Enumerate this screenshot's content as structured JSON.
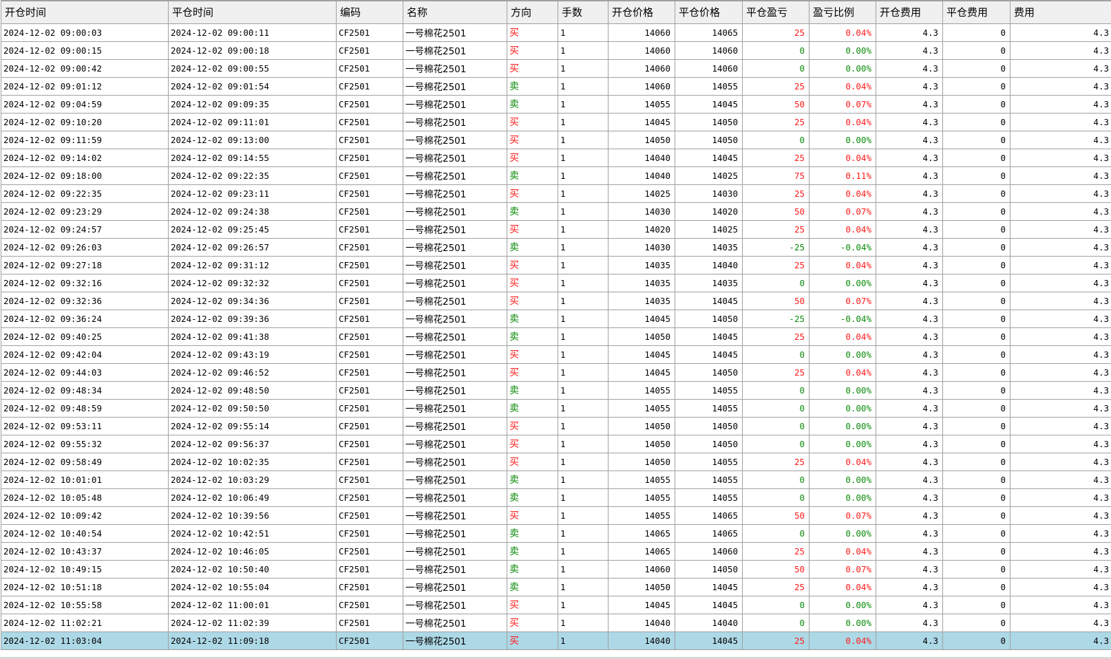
{
  "colors": {
    "buy": "#ff1a1a",
    "sell": "#0a8a0a",
    "gain": "#ff1a1a",
    "flat": "#0a8a0a",
    "loss": "#0a8a0a",
    "selected_row_bg": "#add8e6"
  },
  "selected_row_index": 34,
  "columns": [
    "开仓时间",
    "平仓时间",
    "编码",
    "名称",
    "方向",
    "手数",
    "开仓价格",
    "平仓价格",
    "平仓盈亏",
    "盈亏比例",
    "开仓费用",
    "平仓费用",
    "费用"
  ],
  "rows": [
    [
      "2024-12-02 09:00:03",
      "2024-12-02 09:00:11",
      "CF2501",
      "一号棉花2501",
      "买",
      "1",
      "14060",
      "14065",
      "25",
      "0.04%",
      "4.3",
      "0",
      "4.3"
    ],
    [
      "2024-12-02 09:00:15",
      "2024-12-02 09:00:18",
      "CF2501",
      "一号棉花2501",
      "买",
      "1",
      "14060",
      "14060",
      "0",
      "0.00%",
      "4.3",
      "0",
      "4.3"
    ],
    [
      "2024-12-02 09:00:42",
      "2024-12-02 09:00:55",
      "CF2501",
      "一号棉花2501",
      "买",
      "1",
      "14060",
      "14060",
      "0",
      "0.00%",
      "4.3",
      "0",
      "4.3"
    ],
    [
      "2024-12-02 09:01:12",
      "2024-12-02 09:01:54",
      "CF2501",
      "一号棉花2501",
      "卖",
      "1",
      "14060",
      "14055",
      "25",
      "0.04%",
      "4.3",
      "0",
      "4.3"
    ],
    [
      "2024-12-02 09:04:59",
      "2024-12-02 09:09:35",
      "CF2501",
      "一号棉花2501",
      "卖",
      "1",
      "14055",
      "14045",
      "50",
      "0.07%",
      "4.3",
      "0",
      "4.3"
    ],
    [
      "2024-12-02 09:10:20",
      "2024-12-02 09:11:01",
      "CF2501",
      "一号棉花2501",
      "买",
      "1",
      "14045",
      "14050",
      "25",
      "0.04%",
      "4.3",
      "0",
      "4.3"
    ],
    [
      "2024-12-02 09:11:59",
      "2024-12-02 09:13:00",
      "CF2501",
      "一号棉花2501",
      "买",
      "1",
      "14050",
      "14050",
      "0",
      "0.00%",
      "4.3",
      "0",
      "4.3"
    ],
    [
      "2024-12-02 09:14:02",
      "2024-12-02 09:14:55",
      "CF2501",
      "一号棉花2501",
      "买",
      "1",
      "14040",
      "14045",
      "25",
      "0.04%",
      "4.3",
      "0",
      "4.3"
    ],
    [
      "2024-12-02 09:18:00",
      "2024-12-02 09:22:35",
      "CF2501",
      "一号棉花2501",
      "卖",
      "1",
      "14040",
      "14025",
      "75",
      "0.11%",
      "4.3",
      "0",
      "4.3"
    ],
    [
      "2024-12-02 09:22:35",
      "2024-12-02 09:23:11",
      "CF2501",
      "一号棉花2501",
      "买",
      "1",
      "14025",
      "14030",
      "25",
      "0.04%",
      "4.3",
      "0",
      "4.3"
    ],
    [
      "2024-12-02 09:23:29",
      "2024-12-02 09:24:38",
      "CF2501",
      "一号棉花2501",
      "卖",
      "1",
      "14030",
      "14020",
      "50",
      "0.07%",
      "4.3",
      "0",
      "4.3"
    ],
    [
      "2024-12-02 09:24:57",
      "2024-12-02 09:25:45",
      "CF2501",
      "一号棉花2501",
      "买",
      "1",
      "14020",
      "14025",
      "25",
      "0.04%",
      "4.3",
      "0",
      "4.3"
    ],
    [
      "2024-12-02 09:26:03",
      "2024-12-02 09:26:57",
      "CF2501",
      "一号棉花2501",
      "卖",
      "1",
      "14030",
      "14035",
      "-25",
      "-0.04%",
      "4.3",
      "0",
      "4.3"
    ],
    [
      "2024-12-02 09:27:18",
      "2024-12-02 09:31:12",
      "CF2501",
      "一号棉花2501",
      "买",
      "1",
      "14035",
      "14040",
      "25",
      "0.04%",
      "4.3",
      "0",
      "4.3"
    ],
    [
      "2024-12-02 09:32:16",
      "2024-12-02 09:32:32",
      "CF2501",
      "一号棉花2501",
      "买",
      "1",
      "14035",
      "14035",
      "0",
      "0.00%",
      "4.3",
      "0",
      "4.3"
    ],
    [
      "2024-12-02 09:32:36",
      "2024-12-02 09:34:36",
      "CF2501",
      "一号棉花2501",
      "买",
      "1",
      "14035",
      "14045",
      "50",
      "0.07%",
      "4.3",
      "0",
      "4.3"
    ],
    [
      "2024-12-02 09:36:24",
      "2024-12-02 09:39:36",
      "CF2501",
      "一号棉花2501",
      "卖",
      "1",
      "14045",
      "14050",
      "-25",
      "-0.04%",
      "4.3",
      "0",
      "4.3"
    ],
    [
      "2024-12-02 09:40:25",
      "2024-12-02 09:41:38",
      "CF2501",
      "一号棉花2501",
      "卖",
      "1",
      "14050",
      "14045",
      "25",
      "0.04%",
      "4.3",
      "0",
      "4.3"
    ],
    [
      "2024-12-02 09:42:04",
      "2024-12-02 09:43:19",
      "CF2501",
      "一号棉花2501",
      "买",
      "1",
      "14045",
      "14045",
      "0",
      "0.00%",
      "4.3",
      "0",
      "4.3"
    ],
    [
      "2024-12-02 09:44:03",
      "2024-12-02 09:46:52",
      "CF2501",
      "一号棉花2501",
      "买",
      "1",
      "14045",
      "14050",
      "25",
      "0.04%",
      "4.3",
      "0",
      "4.3"
    ],
    [
      "2024-12-02 09:48:34",
      "2024-12-02 09:48:50",
      "CF2501",
      "一号棉花2501",
      "卖",
      "1",
      "14055",
      "14055",
      "0",
      "0.00%",
      "4.3",
      "0",
      "4.3"
    ],
    [
      "2024-12-02 09:48:59",
      "2024-12-02 09:50:50",
      "CF2501",
      "一号棉花2501",
      "卖",
      "1",
      "14055",
      "14055",
      "0",
      "0.00%",
      "4.3",
      "0",
      "4.3"
    ],
    [
      "2024-12-02 09:53:11",
      "2024-12-02 09:55:14",
      "CF2501",
      "一号棉花2501",
      "买",
      "1",
      "14050",
      "14050",
      "0",
      "0.00%",
      "4.3",
      "0",
      "4.3"
    ],
    [
      "2024-12-02 09:55:32",
      "2024-12-02 09:56:37",
      "CF2501",
      "一号棉花2501",
      "买",
      "1",
      "14050",
      "14050",
      "0",
      "0.00%",
      "4.3",
      "0",
      "4.3"
    ],
    [
      "2024-12-02 09:58:49",
      "2024-12-02 10:02:35",
      "CF2501",
      "一号棉花2501",
      "买",
      "1",
      "14050",
      "14055",
      "25",
      "0.04%",
      "4.3",
      "0",
      "4.3"
    ],
    [
      "2024-12-02 10:01:01",
      "2024-12-02 10:03:29",
      "CF2501",
      "一号棉花2501",
      "卖",
      "1",
      "14055",
      "14055",
      "0",
      "0.00%",
      "4.3",
      "0",
      "4.3"
    ],
    [
      "2024-12-02 10:05:48",
      "2024-12-02 10:06:49",
      "CF2501",
      "一号棉花2501",
      "卖",
      "1",
      "14055",
      "14055",
      "0",
      "0.00%",
      "4.3",
      "0",
      "4.3"
    ],
    [
      "2024-12-02 10:09:42",
      "2024-12-02 10:39:56",
      "CF2501",
      "一号棉花2501",
      "买",
      "1",
      "14055",
      "14065",
      "50",
      "0.07%",
      "4.3",
      "0",
      "4.3"
    ],
    [
      "2024-12-02 10:40:54",
      "2024-12-02 10:42:51",
      "CF2501",
      "一号棉花2501",
      "卖",
      "1",
      "14065",
      "14065",
      "0",
      "0.00%",
      "4.3",
      "0",
      "4.3"
    ],
    [
      "2024-12-02 10:43:37",
      "2024-12-02 10:46:05",
      "CF2501",
      "一号棉花2501",
      "卖",
      "1",
      "14065",
      "14060",
      "25",
      "0.04%",
      "4.3",
      "0",
      "4.3"
    ],
    [
      "2024-12-02 10:49:15",
      "2024-12-02 10:50:40",
      "CF2501",
      "一号棉花2501",
      "卖",
      "1",
      "14060",
      "14050",
      "50",
      "0.07%",
      "4.3",
      "0",
      "4.3"
    ],
    [
      "2024-12-02 10:51:18",
      "2024-12-02 10:55:04",
      "CF2501",
      "一号棉花2501",
      "卖",
      "1",
      "14050",
      "14045",
      "25",
      "0.04%",
      "4.3",
      "0",
      "4.3"
    ],
    [
      "2024-12-02 10:55:58",
      "2024-12-02 11:00:01",
      "CF2501",
      "一号棉花2501",
      "买",
      "1",
      "14045",
      "14045",
      "0",
      "0.00%",
      "4.3",
      "0",
      "4.3"
    ],
    [
      "2024-12-02 11:02:21",
      "2024-12-02 11:02:39",
      "CF2501",
      "一号棉花2501",
      "买",
      "1",
      "14040",
      "14040",
      "0",
      "0.00%",
      "4.3",
      "0",
      "4.3"
    ],
    [
      "2024-12-02 11:03:04",
      "2024-12-02 11:09:18",
      "CF2501",
      "一号棉花2501",
      "买",
      "1",
      "14040",
      "14045",
      "25",
      "0.04%",
      "4.3",
      "0",
      "4.3"
    ]
  ]
}
